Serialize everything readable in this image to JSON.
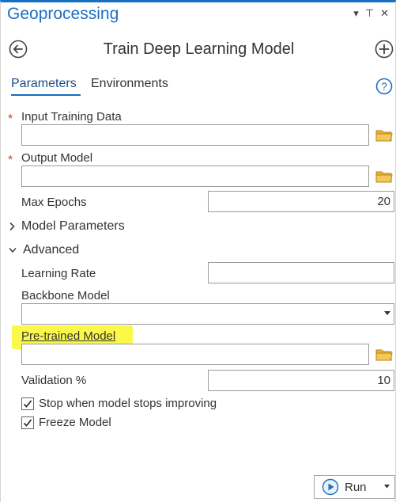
{
  "pane": {
    "title": "Geoprocessing",
    "menu_glyph": "▾",
    "pin_glyph": "⊤",
    "close_glyph": "✕"
  },
  "tool": {
    "title": "Train Deep Learning Model"
  },
  "tabs": [
    {
      "label": "Parameters",
      "selected": true
    },
    {
      "label": "Environments",
      "selected": false
    }
  ],
  "params": {
    "input_training_data": {
      "label": "Input Training Data",
      "value": "",
      "required": true
    },
    "output_model": {
      "label": "Output Model",
      "value": "",
      "required": true
    },
    "max_epochs": {
      "label": "Max Epochs",
      "value": "20"
    },
    "model_parameters": {
      "label": "Model Parameters",
      "expanded": false
    },
    "advanced": {
      "label": "Advanced",
      "expanded": true
    },
    "learning_rate": {
      "label": "Learning Rate",
      "value": ""
    },
    "backbone_model": {
      "label": "Backbone Model",
      "value": ""
    },
    "pretrained_model": {
      "label": "Pre-trained Model",
      "value": "",
      "highlighted": true
    },
    "validation_pct": {
      "label": "Validation %",
      "value": "10"
    },
    "stop_when_no_improve": {
      "label": "Stop when model stops improving",
      "checked": true
    },
    "freeze_model": {
      "label": "Freeze Model",
      "checked": true
    }
  },
  "run": {
    "label": "Run"
  },
  "colors": {
    "accent": "#1570c4",
    "required_star": "#c8452a",
    "highlight": "#fbf84a",
    "folder": "#e8b23a"
  },
  "icons": [
    "back-arrow-icon",
    "add-icon",
    "help-icon",
    "folder-icon",
    "chevron-right-icon",
    "chevron-down-icon",
    "play-icon",
    "check-icon"
  ]
}
